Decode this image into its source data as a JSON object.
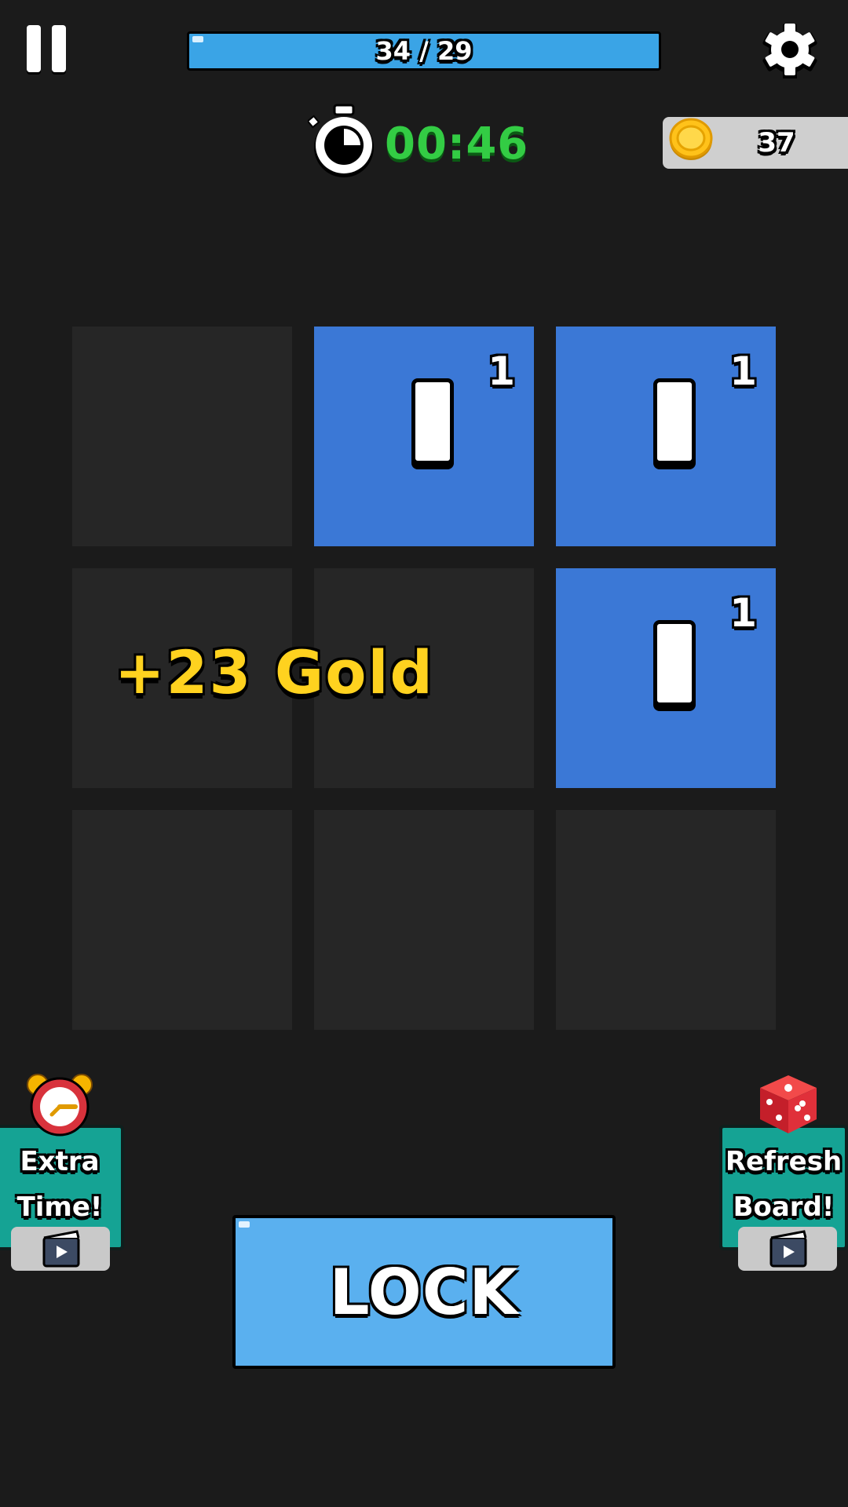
{
  "hud": {
    "progress": {
      "text": "34 / 29",
      "fill_fraction": 1.0,
      "fill_color": "#3aa4e6"
    },
    "timer": {
      "text": "00:46",
      "color": "#33cc44"
    },
    "gold": {
      "value": "37"
    },
    "icons": {
      "pause": "pause-icon",
      "settings": "gear-icon",
      "timer": "stopwatch-icon",
      "coin": "gold-coin-icon"
    }
  },
  "board": {
    "rows": 3,
    "cols": 3,
    "cells": [
      {
        "active": false,
        "count": ""
      },
      {
        "active": true,
        "count": "1"
      },
      {
        "active": true,
        "count": "1"
      },
      {
        "active": false,
        "count": ""
      },
      {
        "active": false,
        "count": ""
      },
      {
        "active": true,
        "count": "1"
      },
      {
        "active": false,
        "count": ""
      },
      {
        "active": false,
        "count": ""
      },
      {
        "active": false,
        "count": ""
      }
    ],
    "colors": {
      "active": "#3b78d6",
      "empty": "#262626"
    }
  },
  "bonus": {
    "text": "+23 Gold",
    "color": "#ffd21f"
  },
  "powerups": {
    "extra_time": {
      "line1": "Extra",
      "line2": "Time!",
      "icon": "alarm-clock-icon",
      "badge_icon": "video-ad-icon"
    },
    "refresh_board": {
      "line1": "Refresh",
      "line2": "Board!",
      "icon": "dice-icon",
      "badge_icon": "video-ad-icon"
    }
  },
  "lock_button": {
    "label": "LOCK",
    "color": "#5ab0ef"
  }
}
